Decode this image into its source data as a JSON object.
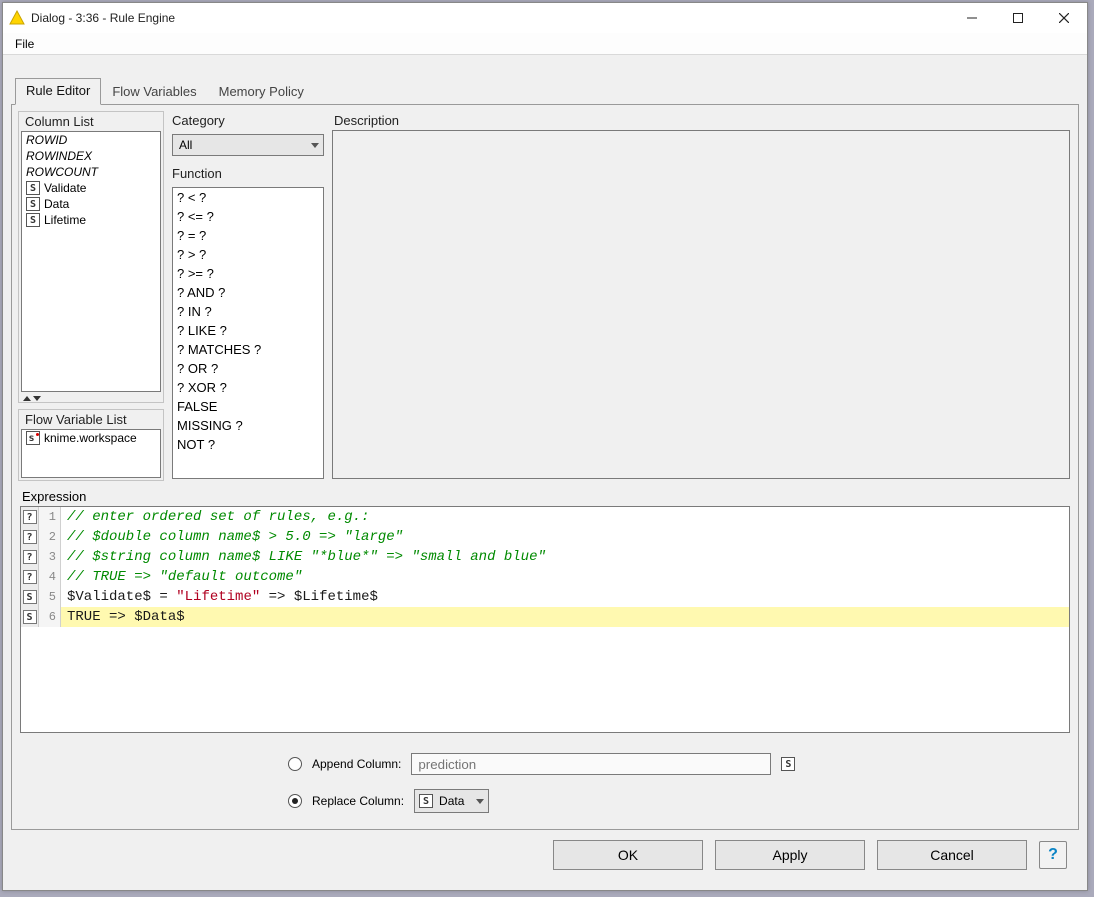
{
  "window": {
    "title": "Dialog - 3:36 - Rule Engine"
  },
  "menu": {
    "file": "File"
  },
  "tabs": [
    {
      "label": "Rule Editor",
      "active": true
    },
    {
      "label": "Flow Variables",
      "active": false
    },
    {
      "label": "Memory Policy",
      "active": false
    }
  ],
  "columnList": {
    "title": "Column List",
    "items": [
      {
        "text": "ROWID",
        "italic": true,
        "badge": null
      },
      {
        "text": "ROWINDEX",
        "italic": true,
        "badge": null
      },
      {
        "text": "ROWCOUNT",
        "italic": true,
        "badge": null
      },
      {
        "text": "Validate",
        "italic": false,
        "badge": "S"
      },
      {
        "text": "Data",
        "italic": false,
        "badge": "S"
      },
      {
        "text": "Lifetime",
        "italic": false,
        "badge": "S"
      }
    ]
  },
  "flowVarList": {
    "title": "Flow Variable List",
    "items": [
      {
        "text": "knime.workspace",
        "badge": "s",
        "redDot": true
      }
    ]
  },
  "category": {
    "title": "Category",
    "selected": "All"
  },
  "function": {
    "title": "Function",
    "items": [
      "? < ?",
      "? <= ?",
      "? = ?",
      "? > ?",
      "? >= ?",
      "? AND ?",
      "? IN ?",
      "? LIKE ?",
      "? MATCHES ?",
      "? OR ?",
      "? XOR ?",
      "FALSE",
      "MISSING ?",
      "NOT ?"
    ]
  },
  "description": {
    "title": "Description"
  },
  "expression": {
    "title": "Expression",
    "lines": [
      {
        "n": 1,
        "gutter": "?",
        "type": "comment",
        "text": "// enter ordered set of rules, e.g.:"
      },
      {
        "n": 2,
        "gutter": "?",
        "type": "comment",
        "text": "// $double column name$ > 5.0 => \"large\""
      },
      {
        "n": 3,
        "gutter": "?",
        "type": "comment",
        "text": "// $string column name$ LIKE \"*blue*\" => \"small and blue\""
      },
      {
        "n": 4,
        "gutter": "?",
        "type": "comment",
        "text": "// TRUE => \"default outcome\""
      },
      {
        "n": 5,
        "gutter": "S",
        "type": "rule1"
      },
      {
        "n": 6,
        "gutter": "S",
        "type": "rule2",
        "highlight": true
      }
    ],
    "rule1": {
      "a": "$Validate$ ",
      "b": "= ",
      "c": "\"Lifetime\"",
      "d": " => ",
      "e": "$Lifetime$"
    },
    "rule2": {
      "a": "TRUE ",
      "b": "=> ",
      "c": "$Data$"
    }
  },
  "output": {
    "appendLabel": "Append Column:",
    "appendPlaceholder": "prediction",
    "replaceLabel": "Replace Column:",
    "replaceValue": "Data"
  },
  "buttons": {
    "ok": "OK",
    "apply": "Apply",
    "cancel": "Cancel"
  }
}
